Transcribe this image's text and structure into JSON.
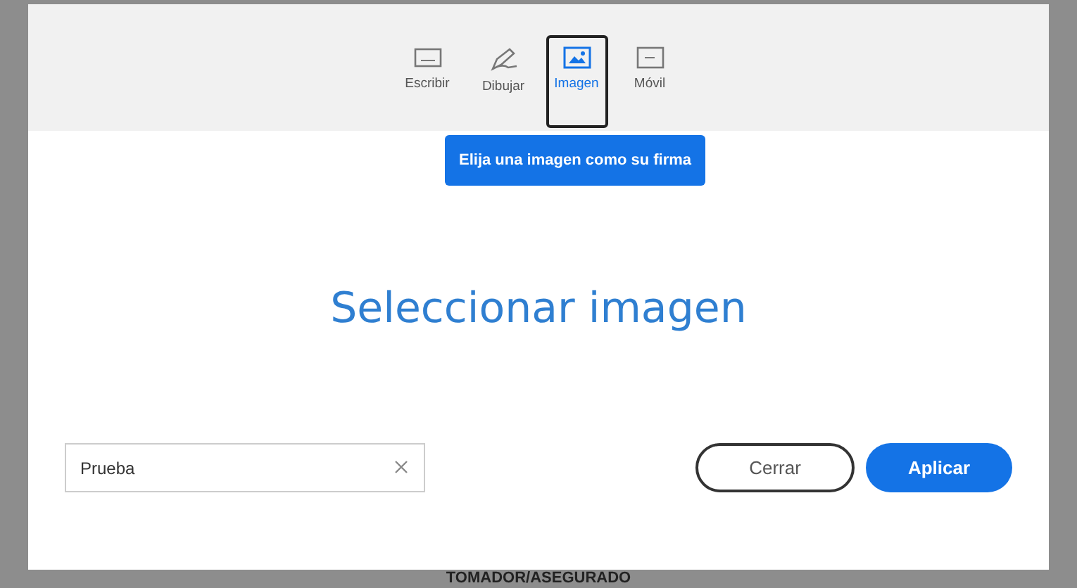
{
  "tabs": [
    {
      "label": "Escribir",
      "kind": "keyboard",
      "selected": false
    },
    {
      "label": "Dibujar",
      "kind": "pen",
      "selected": false
    },
    {
      "label": "Imagen",
      "kind": "image",
      "selected": true
    },
    {
      "label": "Móvil",
      "kind": "mobile",
      "selected": false
    }
  ],
  "tooltip": "Elija una imagen como su firma",
  "select_image": "Seleccionar imagen",
  "name_field": {
    "value": "Prueba"
  },
  "buttons": [
    {
      "label": "Cerrar",
      "kind": "secondary"
    },
    {
      "label": "Aplicar",
      "kind": "primary"
    }
  ],
  "background_text": "TOMADOR/ASEGURADO"
}
